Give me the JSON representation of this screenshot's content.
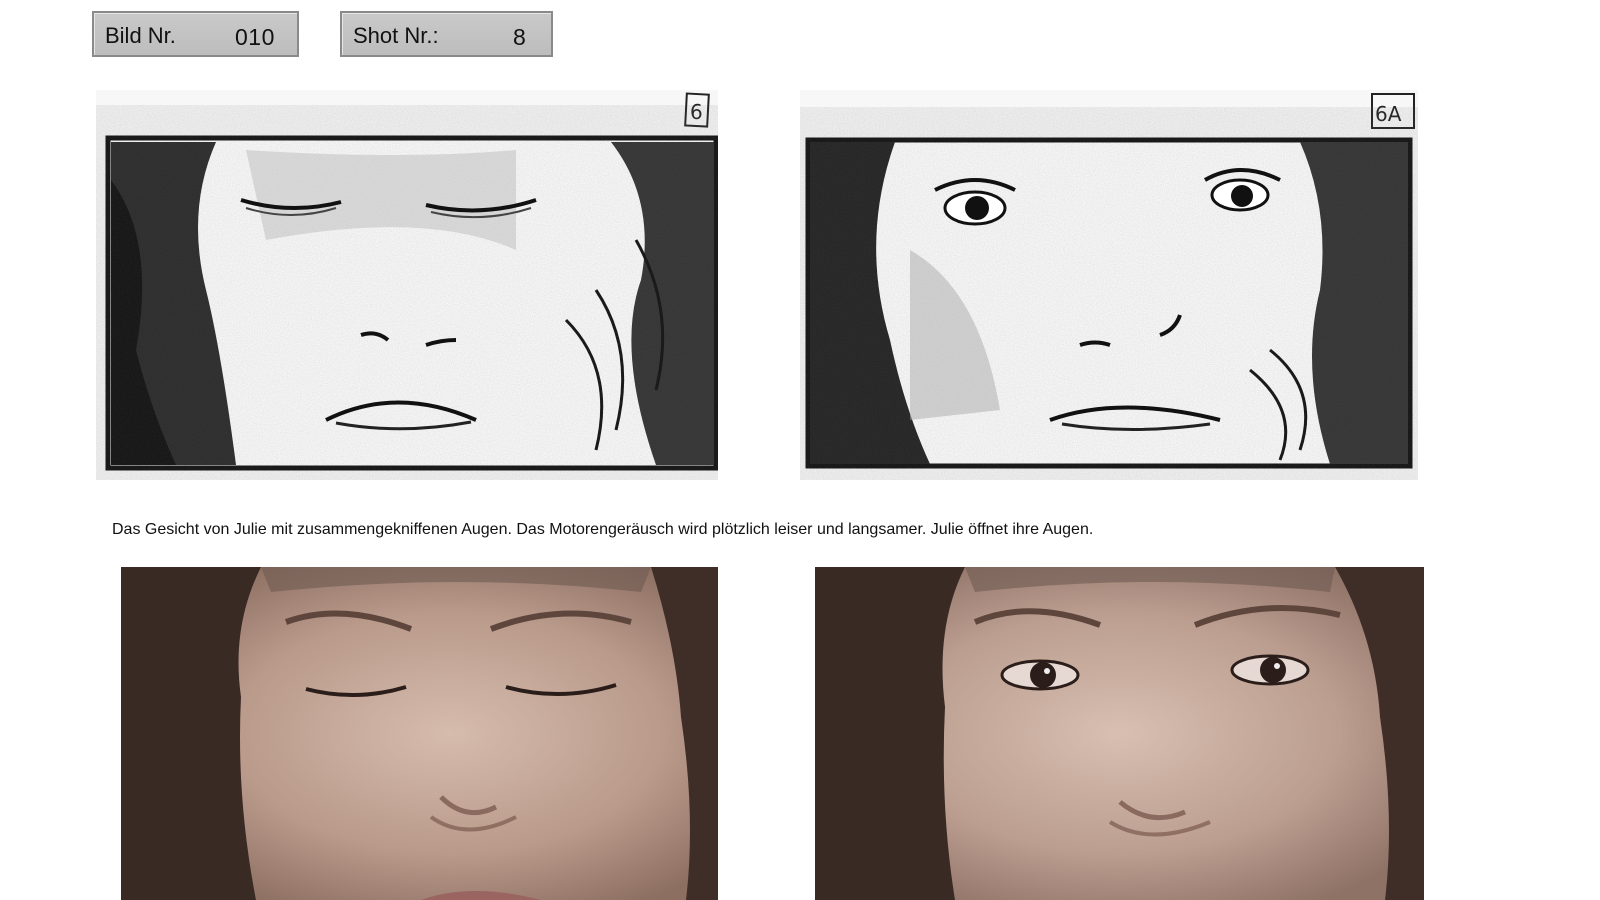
{
  "header": {
    "bild_label": "Bild Nr.",
    "bild_value": "010",
    "shot_label": "Shot Nr.:",
    "shot_value": "8"
  },
  "storyboard": {
    "panels": [
      {
        "number": "6"
      },
      {
        "number": "6A"
      }
    ]
  },
  "description": "Das Gesicht von Julie mit zusammengekniffenen Augen. Das Motorengeräusch wird plötzlich leiser und langsamer. Julie öffnet ihre Augen."
}
